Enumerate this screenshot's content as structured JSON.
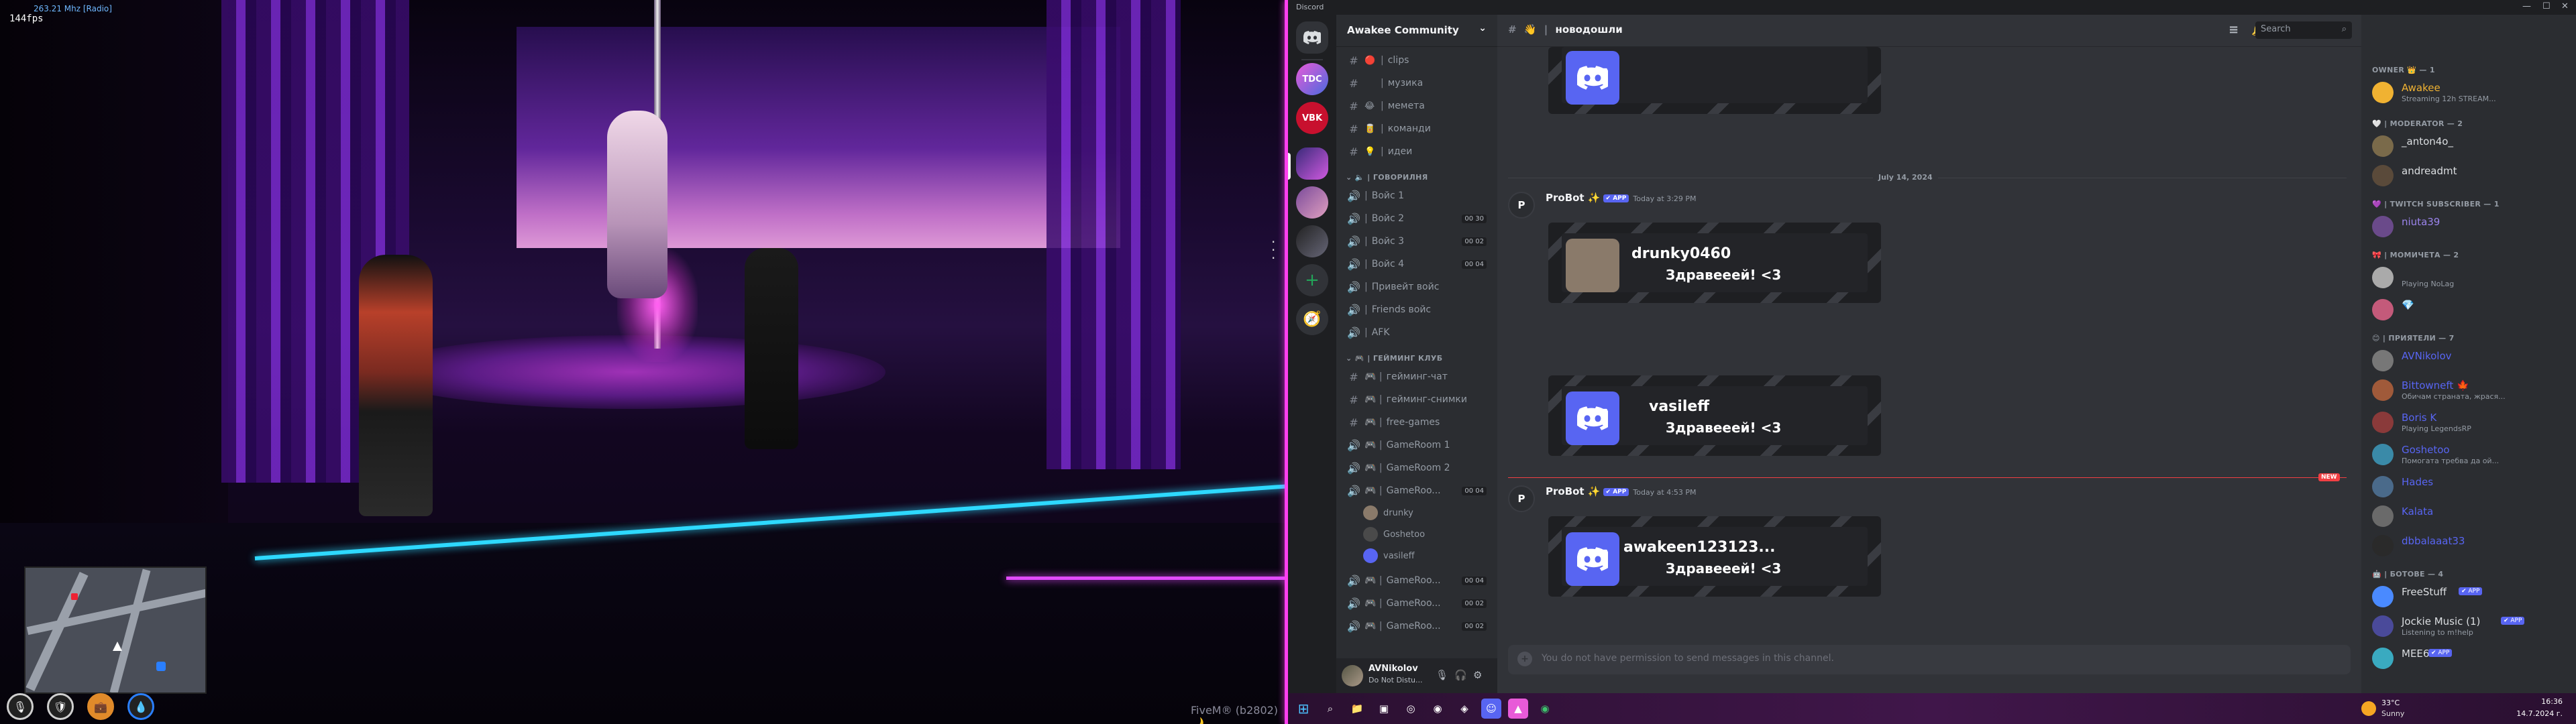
{
  "game": {
    "radio": "263.21 Mhz [Radio]",
    "fps": "144fps",
    "watermark": "FiveM® (b2802) 🌙",
    "hud_icons": [
      "microphone-icon",
      "shield-icon",
      "briefcase-icon",
      "water-drop-icon"
    ]
  },
  "discord": {
    "window_title": "Discord",
    "server_name": "Awakee Community",
    "channels": [
      {
        "icon": "#",
        "emoji": "🔴",
        "label": "clips"
      },
      {
        "icon": "#",
        "emoji": "",
        "label": "музика"
      },
      {
        "icon": "#",
        "emoji": "😂",
        "label": "мемета"
      },
      {
        "icon": "#",
        "emoji": "🥫",
        "label": "команди"
      },
      {
        "icon": "#",
        "emoji": "💡",
        "label": "идеи"
      }
    ],
    "voice_category": "ГОВОРИЛНЯ",
    "voice_channels": [
      {
        "label": "Войс 1",
        "badge": ""
      },
      {
        "label": "Войс 2",
        "badge": "00 30"
      },
      {
        "label": "Войс 3",
        "badge": "00 02"
      },
      {
        "label": "Войс 4",
        "badge": "00 04"
      },
      {
        "label": "Привейт войс",
        "badge": ""
      },
      {
        "label": "Friends войс",
        "badge": ""
      },
      {
        "label": "AFK",
        "badge": ""
      }
    ],
    "gaming_category": "| ГЕЙМИНГ КЛУБ",
    "gaming_channels": [
      {
        "icon": "#",
        "label": "гейминг-чат",
        "badge": ""
      },
      {
        "icon": "#",
        "label": "гейминг-снимки",
        "badge": ""
      },
      {
        "icon": "#",
        "label": "free-games",
        "badge": ""
      },
      {
        "icon": "🔊",
        "label": "GameRoom 1",
        "badge": ""
      },
      {
        "icon": "🔊",
        "label": "GameRoom 2",
        "badge": ""
      },
      {
        "icon": "🔊",
        "label": "GameRoo...",
        "badge": "00 04"
      }
    ],
    "voice_users": [
      "drunky",
      "Goshetoo",
      "vasileff"
    ],
    "more_rooms": [
      {
        "label": "GameRoo...",
        "badge": "00 04"
      },
      {
        "label": "GameRoo...",
        "badge": "00 02"
      },
      {
        "label": "GameRoo...",
        "badge": "00 02"
      }
    ],
    "user": {
      "name": "AVNikolov",
      "status": "Do Not Distu..."
    },
    "channel_title": "новодошли",
    "search_placeholder": "Search",
    "date_divider": "July 14, 2024",
    "new_label": "NEW",
    "bot_name": "ProBot ✨",
    "app_badge": "✔ APP",
    "messages": [
      {
        "time": "Today at 3:29 PM",
        "card_user": "drunky0460",
        "card_greet": "Здравееей! <3"
      },
      {
        "card_user": "vasileff",
        "card_greet": "Здравееей! <3"
      },
      {
        "time": "Today at 4:53 PM",
        "card_user": "awakeen123123...",
        "card_greet": "Здравееей! <3"
      }
    ],
    "input_placeholder": "You do not have permission to send messages in this channel.",
    "members": {
      "owner_cat": "OWNER 👑 — 1",
      "owner": [
        {
          "name": "Awakee",
          "status": "Streaming 12h STREAM...",
          "color": "#f0b232"
        }
      ],
      "mod_cat": "🤍 | MODERATOR — 2",
      "mods": [
        {
          "name": "_anton4o_",
          "status": ""
        },
        {
          "name": "andreadmt",
          "status": ""
        }
      ],
      "twitch_cat": "💜 | TWITCH SUBSCRIBER — 1",
      "twitch": [
        {
          "name": "niuta39",
          "status": ""
        }
      ],
      "girls_cat": "🎀 | МОМИЧЕТА — 2",
      "girls": [
        {
          "name": "",
          "status": "Playing NoLag"
        },
        {
          "name": "💎",
          "status": ""
        }
      ],
      "friends_cat": "😊 | ПРИЯТЕЛИ — 7",
      "friends": [
        {
          "name": "AVNikolov",
          "status": ""
        },
        {
          "name": "Bittowneft 🍁",
          "status": "Обичам страната, жрася..."
        },
        {
          "name": "Boris K",
          "status": "Playing LegendsRP"
        },
        {
          "name": "Goshetoo",
          "status": "Помогата требва да ой..."
        },
        {
          "name": "Hades",
          "status": ""
        },
        {
          "name": "Kalata",
          "status": ""
        },
        {
          "name": "dbbalaaat33",
          "status": ""
        }
      ],
      "bots_cat": "🤖 | БОТОВЕ — 4",
      "bots": [
        {
          "name": "FreeStuff",
          "status": ""
        },
        {
          "name": "Jockie Music (1)",
          "status": "Listening to m!help"
        },
        {
          "name": "MEE6",
          "status": ""
        }
      ]
    },
    "taskbar": {
      "weather_temp": "33°C",
      "weather_desc": "Sunny",
      "time": "16:36",
      "date": "14.7.2024 г."
    }
  },
  "colors": {
    "blurple": "#5865f2",
    "friend_name": "#5865f2",
    "mod_name": "#dbdee1",
    "new_red": "#f23f43"
  }
}
